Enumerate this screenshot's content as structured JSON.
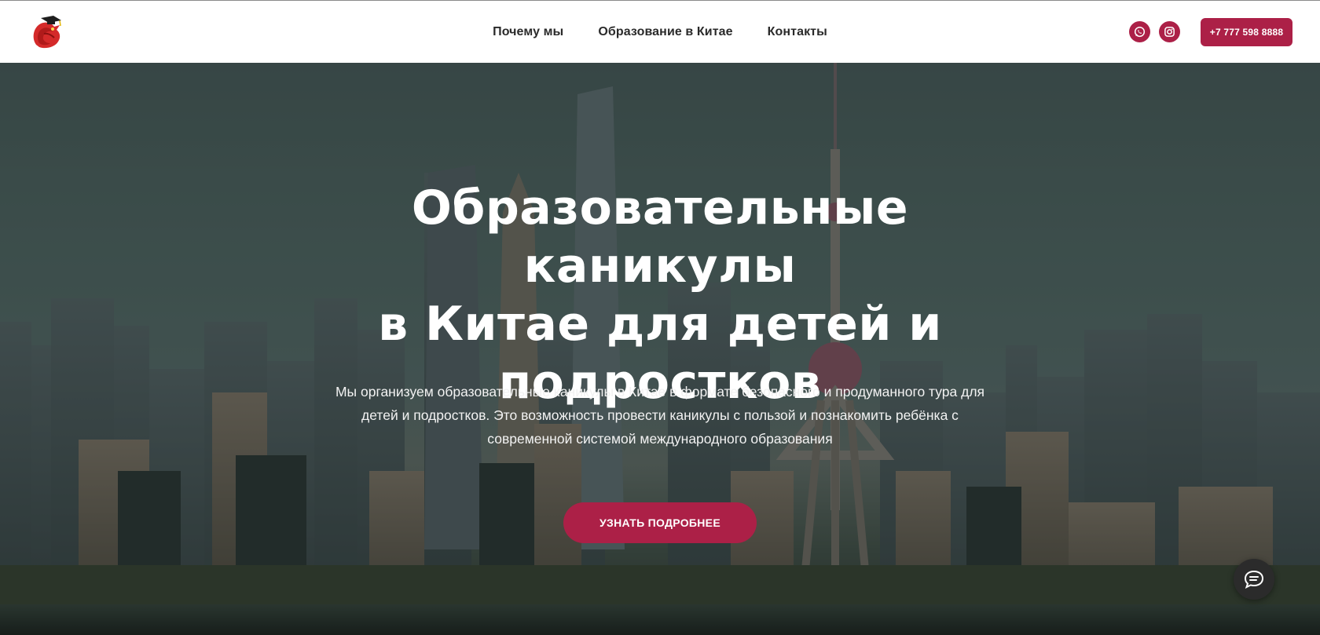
{
  "header": {
    "logo_icon": "dragon-graduation-cap-logo",
    "nav": [
      {
        "label": "Почему мы"
      },
      {
        "label": "Образование в Китае"
      },
      {
        "label": "Контакты"
      }
    ],
    "socials": [
      {
        "icon": "whatsapp-icon"
      },
      {
        "icon": "instagram-icon"
      }
    ],
    "phone_label": "+7 777 598 8888"
  },
  "hero": {
    "title_line1": "Образовательные каникулы",
    "title_line2": "в Китае для детей и",
    "title_line3": "подростков",
    "description_line1": "Мы организуем образовательные каникулы в Китае в формате безопасного и продуманного тура для",
    "description_line2": "детей и подростков. Это возможность провести каникулы с пользой и познакомить ребёнка с",
    "description_line3": "современной системой международного образования",
    "cta_label": "УЗНАТЬ ПОДРОБНЕЕ",
    "chat_icon": "chat-bubble-icon"
  },
  "colors": {
    "accent": "#ac2047",
    "header_bg": "#ffffff",
    "nav_text": "#2a2a2a",
    "hero_text": "#ffffff"
  }
}
